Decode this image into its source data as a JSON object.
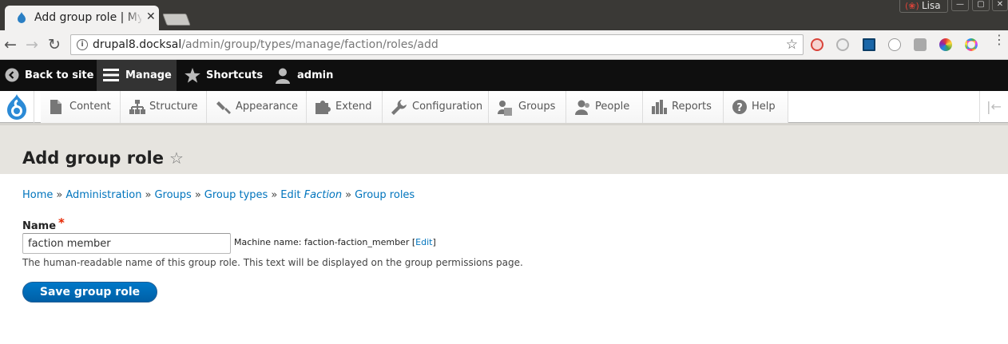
{
  "browser": {
    "tab_title": "Add group role | My",
    "profile_name": "Lisa",
    "url_host": "drupal8.docksal",
    "url_path": "/admin/group/types/manage/faction/roles/add",
    "extension_icons": [
      "noscript-icon",
      "blocked-icon",
      "linkedin-icon",
      "code-icon",
      "refresh-ext-icon",
      "color-picker-icon",
      "chrome-color-icon"
    ]
  },
  "admin_bar": {
    "back": "Back to site",
    "manage": "Manage",
    "shortcuts": "Shortcuts",
    "user": "admin"
  },
  "tray": {
    "items": [
      "Content",
      "Structure",
      "Appearance",
      "Extend",
      "Configuration",
      "Groups",
      "People",
      "Reports",
      "Help"
    ]
  },
  "page": {
    "title": "Add group role"
  },
  "breadcrumb": {
    "home": "Home",
    "administration": "Administration",
    "groups": "Groups",
    "group_types": "Group types",
    "edit_prefix": "Edit",
    "edit_name": "Faction",
    "group_roles": "Group roles",
    "separator": "»"
  },
  "form": {
    "name_label": "Name",
    "required_marker": "*",
    "name_value": "faction member",
    "machine_name_prefix": "Machine name: faction-faction_member",
    "machine_edit": "Edit",
    "description": "The human-readable name of this group role. This text will be displayed on the group permissions page.",
    "save_label": "Save group role"
  },
  "colors": {
    "link": "#0074bd",
    "admin_bar": "#0f0f0f",
    "header_bg": "#e6e4df",
    "button": "#0071bc",
    "required": "#e62600"
  }
}
